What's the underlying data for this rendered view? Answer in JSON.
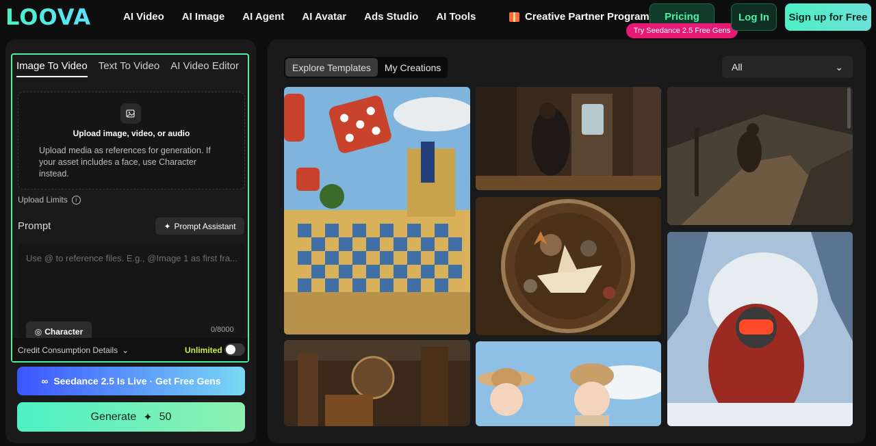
{
  "brand": {
    "logo_text": "LOOVA",
    "accent": "#4df0a4"
  },
  "nav": {
    "items": [
      "AI Video",
      "AI Image",
      "AI Agent",
      "AI Avatar",
      "Ads Studio",
      "AI Tools"
    ],
    "partner": "Creative Partner Program",
    "pricing": "Pricing",
    "promo": "Try Seedance 2.5 Free Gens",
    "login": "Log In",
    "signup": "Sign up for Free"
  },
  "editor": {
    "tabs": [
      "Image To Video",
      "Text To Video",
      "AI Video Editor"
    ],
    "active_tab": "Image To Video",
    "upload_title": "Upload image, video, or audio",
    "upload_desc": "Upload media as references for generation. If your asset includes a face, use Character instead.",
    "upload_limits": "Upload Limits",
    "prompt_label": "Prompt",
    "prompt_assistant": "Prompt Assistant",
    "prompt_placeholder": "Use @ to reference files. E.g., @Image 1 as first fra...",
    "character": "Character",
    "counter": "0/8000",
    "credit_details": "Credit Consumption Details",
    "unlimited": "Unlimited",
    "unlimited_on": false
  },
  "actions": {
    "seedance": "Seedance 2.5 Is Live · Get Free Gens",
    "generate": "Generate",
    "generate_cost": "50"
  },
  "gallery": {
    "tabs": [
      "Explore Templates",
      "My Creations"
    ],
    "active_tab": "Explore Templates",
    "filter": "All"
  }
}
